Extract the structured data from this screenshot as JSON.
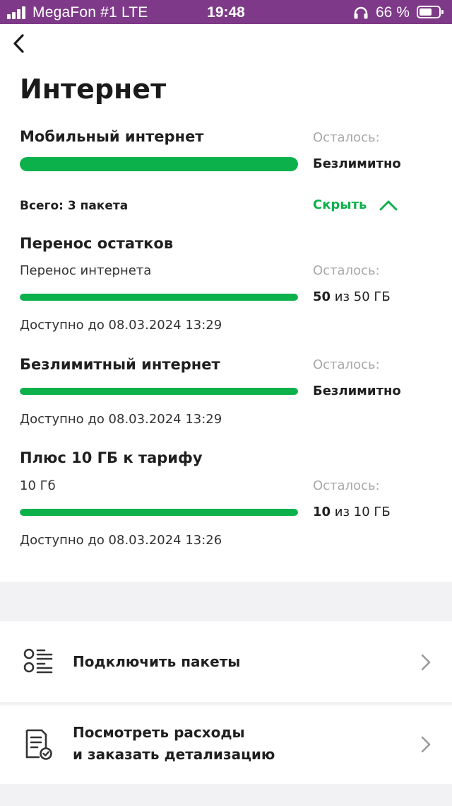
{
  "status_bar": {
    "carrier": "MegaFon #1  LTE",
    "time": "19:48",
    "battery": "66 %",
    "battery_level": 0.66,
    "colors": {
      "background": "#7e3a88"
    }
  },
  "page": {
    "title": "Интернет"
  },
  "mobile_internet": {
    "title": "Мобильный интернет",
    "remaining_label": "Осталось:",
    "remaining_value": "Безлимитно",
    "progress": 1.0
  },
  "packages": {
    "total_label": "Всего: 3 пакета",
    "hide_label": "Скрыть",
    "items": [
      {
        "title": "Перенос остатков",
        "subtitle": "Перенос интернета",
        "remaining_label": "Осталось:",
        "remaining_amount": "50",
        "remaining_rest": " из 50 ГБ",
        "progress": 1.0,
        "available_until": "Доступно до 08.03.2024 13:29"
      },
      {
        "title": "Безлимитный интернет",
        "remaining_label": "Осталось:",
        "remaining_value": "Безлимитно",
        "progress": 1.0,
        "available_until": "Доступно до 08.03.2024 13:29"
      },
      {
        "title": "Плюс 10 ГБ к тарифу",
        "subtitle": "10 Гб",
        "remaining_label": "Осталось:",
        "remaining_amount": "10",
        "remaining_rest": " из 10 ГБ",
        "progress": 1.0,
        "available_until": "Доступно до 08.03.2024 13:26"
      }
    ]
  },
  "menu": {
    "connect_packages": "Подключить пакеты",
    "expenses_line1": "Посмотреть расходы",
    "expenses_line2": "и заказать детализацию"
  },
  "colors": {
    "accent": "#0db14b",
    "muted": "#a8a8a8"
  },
  "icons": [
    "signal-icon",
    "headphones-icon",
    "battery-icon",
    "back-arrow-icon",
    "chevron-up-icon",
    "list-options-icon",
    "document-check-icon",
    "chevron-right-icon"
  ]
}
